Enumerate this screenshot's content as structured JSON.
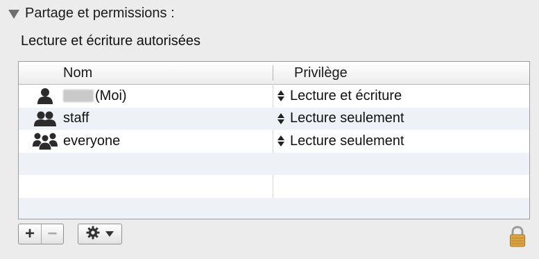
{
  "section": {
    "title": "Partage et permissions :",
    "icon": "disclosure-triangle-down-icon"
  },
  "status_text": "Lecture et écriture autorisées",
  "table": {
    "columns": [
      "Nom",
      "Privilège"
    ],
    "rows": [
      {
        "name_suffix": "(Moi)",
        "name_redacted": true,
        "icon": "single-user-icon",
        "privilege": "Lecture et écriture"
      },
      {
        "name_suffix": "staff",
        "name_redacted": false,
        "icon": "group-icon",
        "privilege": "Lecture seulement"
      },
      {
        "name_suffix": "everyone",
        "name_redacted": false,
        "icon": "everyone-group-icon",
        "privilege": "Lecture seulement"
      }
    ],
    "empty_rows": 3
  },
  "toolbar": {
    "add_label": "+",
    "remove_label": "−",
    "remove_enabled": false,
    "action_icon": "gear-icon"
  },
  "lock_icon": "lock-icon",
  "colors": {
    "row_alt": "#eef2f7",
    "lock": "#d9a441"
  }
}
